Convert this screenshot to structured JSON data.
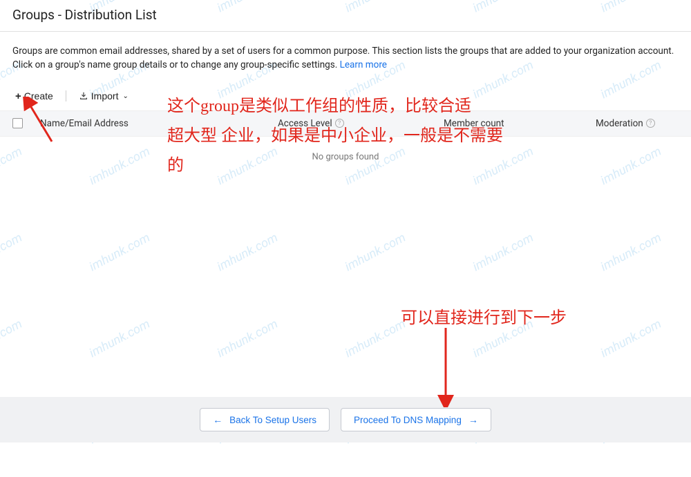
{
  "header": {
    "title": "Groups - Distribution List"
  },
  "description": {
    "text": "Groups are common email addresses, shared by a set of users for a common purpose. This section lists the groups that are added to your organization account. Click on a group's name group details or to change any group-specific settings. ",
    "learn_more": "Learn more"
  },
  "toolbar": {
    "create_label": "Create",
    "import_label": "Import"
  },
  "table": {
    "columns": {
      "name": "Name/Email Address",
      "access": "Access Level",
      "member": "Member count",
      "moderation": "Moderation"
    },
    "empty": "No groups found"
  },
  "footer": {
    "back_label": "Back To Setup Users",
    "proceed_label": "Proceed To DNS Mapping"
  },
  "annotations": {
    "top_line1": "这个group是类似工作组的性质，比较合适",
    "top_line2": "超大型 企业，如果是中小企业，一般是不需要",
    "top_line3": "的",
    "bottom": "可以直接进行到下一步"
  },
  "watermark_text": "imhunk.com"
}
